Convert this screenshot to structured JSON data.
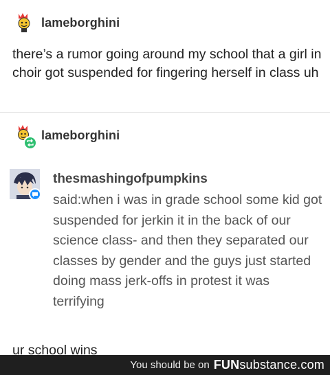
{
  "post": {
    "username": "lameborghini",
    "text": "there’s a rumor going around my school that a girl in choir got suspended for fingering herself in class uh"
  },
  "reblog": {
    "username": "lameborghini",
    "ask": {
      "asker": "thesmashingofpumpkins",
      "body": "said:when i was in grade school some kid got suspended for jerkin it in the back of our science class- and then they separated our classes by gender and the guys just started doing mass jerk-offs in protest it was terrifying"
    },
    "reply": "ur school wins"
  },
  "footer": {
    "prefix": "You should be on",
    "brand_bold": "FUN",
    "brand_rest": "substance.com"
  },
  "colors": {
    "footer_bg": "#1f1f1f",
    "reblog_badge": "#2fbf71",
    "ask_badge": "#1e90ff"
  }
}
